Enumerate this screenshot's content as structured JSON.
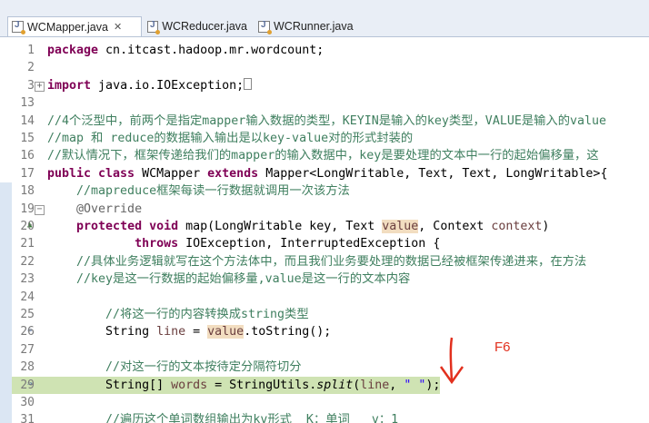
{
  "tabs": [
    {
      "label": "WCMapper.java",
      "close": "✕"
    },
    {
      "label": "WCReducer.java"
    },
    {
      "label": "WCRunner.java"
    }
  ],
  "lines": [
    {
      "n": "1",
      "t": "package cn.itcast.hadoop.mr.wordcount;"
    },
    {
      "n": "2",
      "t": ""
    },
    {
      "n": "3",
      "t": "import java.io.IOException;"
    },
    {
      "n": "13",
      "t": ""
    },
    {
      "n": "14",
      "t": "//4个泛型中，前两个是指定mapper输入数据的类型，KEYIN是输入的key类型，VALUE是输入的value"
    },
    {
      "n": "15",
      "t": "//map 和 reduce的数据输入输出是以key-value对的形式封装的"
    },
    {
      "n": "16",
      "t": "//默认情况下，框架传递给我们的mapper的输入数据中，key是要处理的文本中一行的起始偏移量，这"
    },
    {
      "n": "17",
      "t": "public class WCMapper extends Mapper<LongWritable, Text, Text, LongWritable>{"
    },
    {
      "n": "18",
      "t": "    //mapreduce框架每读一行数据就调用一次该方法"
    },
    {
      "n": "19",
      "t": "    @Override"
    },
    {
      "n": "20",
      "t": "    protected void map(LongWritable key, Text value, Context context)"
    },
    {
      "n": "21",
      "t": "            throws IOException, InterruptedException {"
    },
    {
      "n": "22",
      "t": "    //具体业务逻辑就写在这个方法体中，而且我们业务要处理的数据已经被框架传递进来，在方法"
    },
    {
      "n": "23",
      "t": "    //key是这一行数据的起始偏移量,value是这一行的文本内容"
    },
    {
      "n": "24",
      "t": ""
    },
    {
      "n": "25",
      "t": "        //将这一行的内容转换成string类型"
    },
    {
      "n": "26",
      "t": "        String line = value.toString();"
    },
    {
      "n": "27",
      "t": ""
    },
    {
      "n": "28",
      "t": "        //对这一行的文本按待定分隔符切分"
    },
    {
      "n": "29",
      "t": "        String[] words = StringUtils.split(line, \" \");"
    },
    {
      "n": "30",
      "t": ""
    },
    {
      "n": "31",
      "t": "        //遍历这个单词数组输出为kv形式  K：单词   v：1"
    }
  ],
  "annotation": {
    "label": "F6",
    "color": "#e2301e"
  },
  "highlight_color": "#cfe3b3"
}
